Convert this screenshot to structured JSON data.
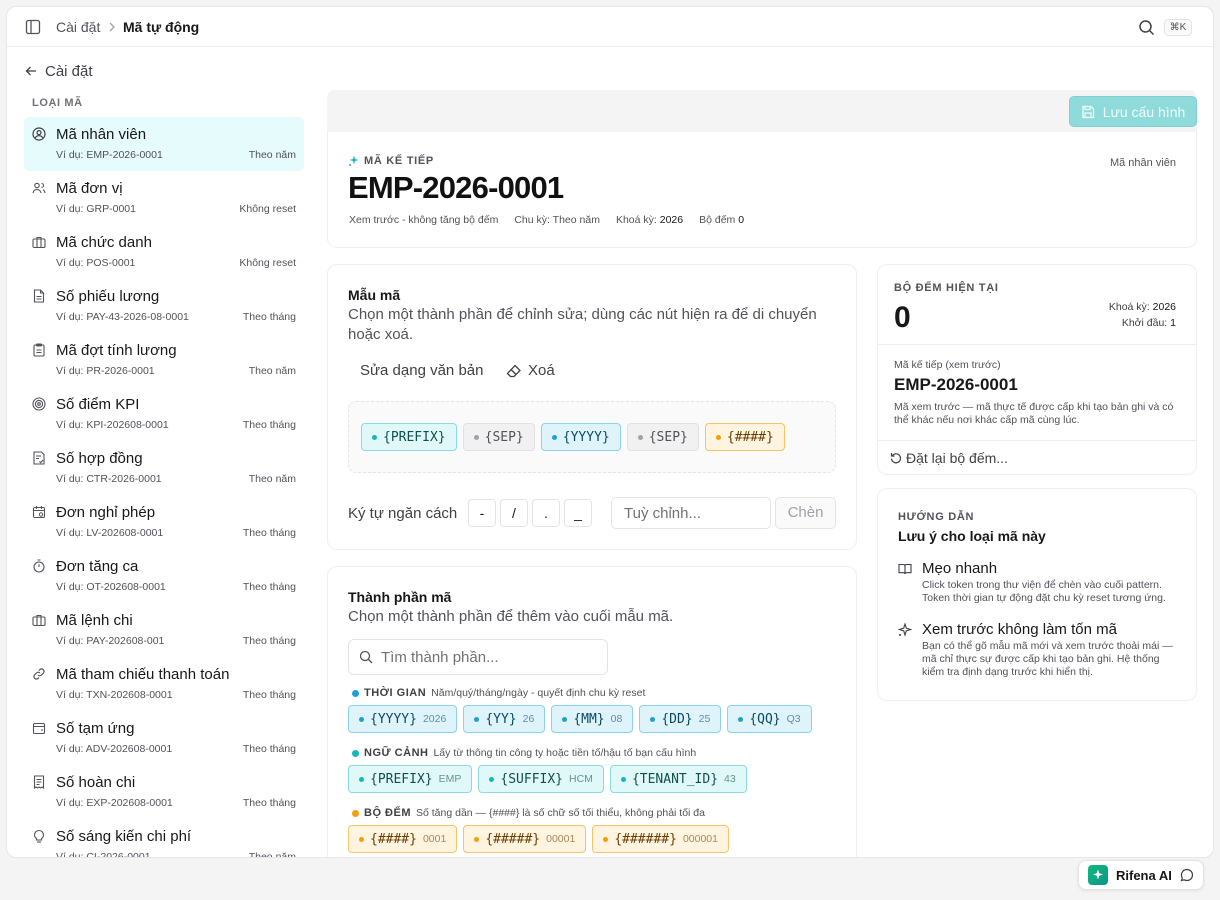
{
  "breadcrumb": {
    "parent": "Cài đặt",
    "current": "Mã tự động"
  },
  "topbar": {
    "kbd": "⌘K"
  },
  "back": {
    "label": "Cài đặt"
  },
  "sidebar": {
    "title": "LOẠI MÃ",
    "items": [
      {
        "name": "Mã nhân viên",
        "example": "Ví dụ: EMP-2026-0001",
        "reset": "Theo năm",
        "icon": "user-circle-icon"
      },
      {
        "name": "Mã đơn vị",
        "example": "Ví dụ: GRP-0001",
        "reset": "Không reset",
        "icon": "users-icon"
      },
      {
        "name": "Mã chức danh",
        "example": "Ví dụ: POS-0001",
        "reset": "Không reset",
        "icon": "briefcase-icon"
      },
      {
        "name": "Số phiếu lương",
        "example": "Ví dụ: PAY-43-2026-08-0001",
        "reset": "Theo tháng",
        "icon": "document-icon"
      },
      {
        "name": "Mã đợt tính lương",
        "example": "Ví dụ: PR-2026-0001",
        "reset": "Theo năm",
        "icon": "clipboard-icon"
      },
      {
        "name": "Số điểm KPI",
        "example": "Ví dụ: KPI-202608-0001",
        "reset": "Theo tháng",
        "icon": "target-icon"
      },
      {
        "name": "Số hợp đồng",
        "example": "Ví dụ: CTR-2026-0001",
        "reset": "Theo năm",
        "icon": "contract-icon"
      },
      {
        "name": "Đơn nghỉ phép",
        "example": "Ví dụ: LV-202608-0001",
        "reset": "Theo tháng",
        "icon": "calendar-icon"
      },
      {
        "name": "Đơn tăng ca",
        "example": "Ví dụ: OT-202608-0001",
        "reset": "Theo tháng",
        "icon": "timer-icon"
      },
      {
        "name": "Mã lệnh chi",
        "example": "Ví dụ: PAY-202608-001",
        "reset": "Theo tháng",
        "icon": "briefcase-icon"
      },
      {
        "name": "Mã tham chiếu thanh toán",
        "example": "Ví dụ: TXN-202608-0001",
        "reset": "Theo tháng",
        "icon": "link-icon"
      },
      {
        "name": "Số tạm ứng",
        "example": "Ví dụ: ADV-202608-0001",
        "reset": "Theo tháng",
        "icon": "wallet-icon"
      },
      {
        "name": "Số hoàn chi",
        "example": "Ví dụ: EXP-202608-0001",
        "reset": "Theo tháng",
        "icon": "receipt-icon"
      },
      {
        "name": "Số sáng kiến chi phí",
        "example": "Ví dụ: CI-2026-0001",
        "reset": "Theo năm",
        "icon": "lightbulb-icon"
      }
    ]
  },
  "toolbar": {
    "save_label": "Lưu cấu hình"
  },
  "next_code": {
    "kicker": "MÃ KẾ TIẾP",
    "type_label": "Mã nhân viên",
    "code": "EMP-2026-0001",
    "preview_note": "Xem trước - không tăng bộ đếm",
    "cycle_label": "Chu kỳ:",
    "cycle_value": "Theo năm",
    "lock_label": "Khoá kỳ:",
    "lock_value": "2026",
    "counter_label": "Bộ đếm",
    "counter_value": "0"
  },
  "pattern": {
    "title": "Mẫu mã",
    "desc": "Chọn một thành phần để chỉnh sửa; dùng các nút hiện ra để di chuyển hoặc xoá.",
    "edit_text_label": "Sửa dạng văn bản",
    "clear_label": "Xoá",
    "tokens": [
      {
        "label": "{PREFIX}",
        "kind": "teal"
      },
      {
        "label": "{SEP}",
        "kind": "gray"
      },
      {
        "label": "{YYYY}",
        "kind": "blue"
      },
      {
        "label": "{SEP}",
        "kind": "gray"
      },
      {
        "label": "{####}",
        "kind": "amber"
      }
    ],
    "separator_label": "Ký tự ngăn cách",
    "separators": [
      "-",
      "/",
      ".",
      "_"
    ],
    "custom_placeholder": "Tuỳ chỉnh...",
    "insert_label": "Chèn"
  },
  "components": {
    "title": "Thành phần mã",
    "desc": "Chọn một thành phần để thêm vào cuối mẫu mã.",
    "search_placeholder": "Tìm thành phần...",
    "groups": [
      {
        "name": "THỜI GIAN",
        "desc": "Năm/quý/tháng/ngày - quyết định chu kỳ reset",
        "color": "#1ea0d6",
        "kind": "blue",
        "tokens": [
          {
            "label": "{YYYY}",
            "sample": "2026"
          },
          {
            "label": "{YY}",
            "sample": "26"
          },
          {
            "label": "{MM}",
            "sample": "08"
          },
          {
            "label": "{DD}",
            "sample": "25"
          },
          {
            "label": "{QQ}",
            "sample": "Q3"
          }
        ]
      },
      {
        "name": "NGỮ CẢNH",
        "desc": "Lấy từ thông tin công ty hoặc tiền tố/hậu tố bạn cấu hình",
        "color": "#14b8b8",
        "kind": "teal",
        "tokens": [
          {
            "label": "{PREFIX}",
            "sample": "EMP"
          },
          {
            "label": "{SUFFIX}",
            "sample": "HCM"
          },
          {
            "label": "{TENANT_ID}",
            "sample": "43"
          }
        ]
      },
      {
        "name": "BỘ ĐẾM",
        "desc": "Số tăng dần — {####} là số chữ số tối thiểu, không phải tối đa",
        "color": "#f59e0b",
        "kind": "amber",
        "tokens": [
          {
            "label": "{####}",
            "sample": "0001"
          },
          {
            "label": "{#####}",
            "sample": "00001"
          },
          {
            "label": "{######}",
            "sample": "000001"
          }
        ]
      }
    ]
  },
  "counter": {
    "title": "BỘ ĐẾM HIỆN TẠI",
    "value": "0",
    "lock_label": "Khoá kỳ:",
    "lock_value": "2026",
    "start_label": "Khởi đầu:",
    "start_value": "1",
    "preview_label": "Mã kế tiếp (xem trước)",
    "preview_code": "EMP-2026-0001",
    "preview_note": "Mã xem trước — mã thực tế được cấp khi tạo bản ghi và có thể khác nếu nơi khác cấp mã cùng lúc.",
    "reset_label": "Đặt lại bộ đếm..."
  },
  "guide": {
    "title": "HƯỚNG DẪN",
    "subtitle": "Lưu ý cho loại mã này",
    "tips": [
      {
        "title": "Mẹo nhanh",
        "desc": "Click token trong thư viện để chèn vào cuối pattern. Token thời gian tự động đặt chu kỳ reset tương ứng."
      },
      {
        "title": "Xem trước không làm tốn mã",
        "desc": "Bạn có thể gõ mẫu mã mới và xem trước thoải mái — mã chỉ thực sự được cấp khi tạo bản ghi. Hệ thống kiểm tra định dạng trước khi hiển thị."
      }
    ]
  },
  "ai": {
    "label": "Rifena AI"
  },
  "colors": {
    "accent": "#14b8b8",
    "save_button": "#8fdada",
    "active_item": "#e6fbfb"
  }
}
